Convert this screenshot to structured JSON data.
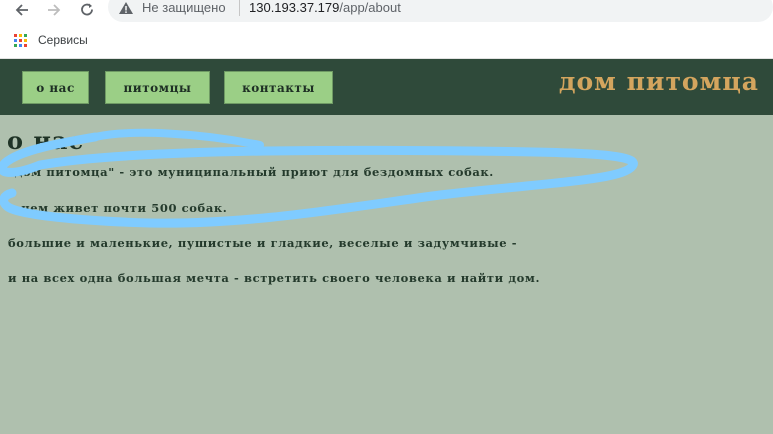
{
  "browser": {
    "security_text": "Не защищено",
    "url_host": "130.193.37.179",
    "url_path": "/app/about",
    "bookmarks": [
      {
        "label": "Сервисы",
        "icon": "apps-grid-icon"
      }
    ],
    "icons": [
      "back-arrow-icon",
      "forward-arrow-icon",
      "reload-icon",
      "warning-icon"
    ]
  },
  "site": {
    "nav": [
      {
        "label": "о нас"
      },
      {
        "label": "питомцы"
      },
      {
        "label": "контакты"
      }
    ],
    "brand": "дом питомца",
    "title": "о нас",
    "paragraphs": [
      "\"дом питомца\" - это муниципальный приют для бездомных собак.",
      "в нем живет почти 500 собак.",
      "большие и маленькие, пушистые и гладкие, веселые и задумчивые -",
      "и на всех одна большая мечта - встретить своего человека и найти дом."
    ]
  },
  "colors": {
    "header_bg": "#2f4a3a",
    "nav_button_bg": "#9bcf86",
    "brand": "#d4a55e",
    "content_bg": "#afc0ae",
    "scribble": "#7fcbff"
  }
}
